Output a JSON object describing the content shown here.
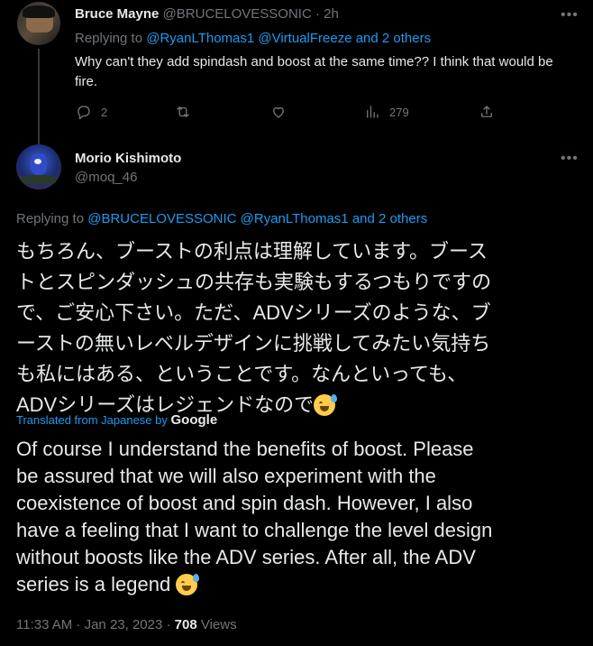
{
  "reply_tweet": {
    "display_name": "Bruce Mayne",
    "handle": "@BRUCELOVESSONIC",
    "time": "· 2h",
    "replying_prefix": "Replying to ",
    "replying_to": "@RyanLThomas1 @VirtualFreeze and 2 others",
    "text": "Why can't they add spindash and boost at the same time?? I think that would be fire.",
    "reply_count": "2",
    "views": "279"
  },
  "main_tweet": {
    "display_name": "Morio Kishimoto",
    "handle": "@moq_46",
    "replying_prefix": "Replying to ",
    "replying_to": "@BRUCELOVESSONIC @RyanLThomas1 and 2 others",
    "jp_lines": [
      "もちろん、ブーストの利点は理解しています。ブース",
      "トとスピンダッシュの共存も実験もするつもりですの",
      "で、ご安心下さい。ただ、ADVシリーズのような、ブ",
      "ーストの無いレベルデザインに挑戦してみたい気持ち",
      "も私にはある、ということです。なんといっても、",
      "ADVシリーズはレジェンドなので"
    ],
    "translated_label": "Translated from Japanese by",
    "translator": "Google",
    "en_lines": [
      "Of course I understand the benefits of boost. Please",
      "be assured that we will also experiment with the",
      "coexistence of boost and spin dash. However, I also",
      "have a feeling that I want to challenge the level design",
      "without boosts like the ADV series. After all, the ADV",
      "series is a legend"
    ],
    "timestamp": "11:33 AM · Jan 23, 2023 · ",
    "view_count": "708",
    "views_label": " Views"
  },
  "icons": {
    "more": "more-icon",
    "reply": "reply-icon",
    "retweet": "retweet-icon",
    "like": "like-icon",
    "views": "views-icon",
    "share": "share-icon",
    "emoji": "sweat-smile-emoji"
  },
  "colors": {
    "background": "#000000",
    "text": "#e7e9ea",
    "muted": "#71767b",
    "link": "#1d9bf0"
  }
}
